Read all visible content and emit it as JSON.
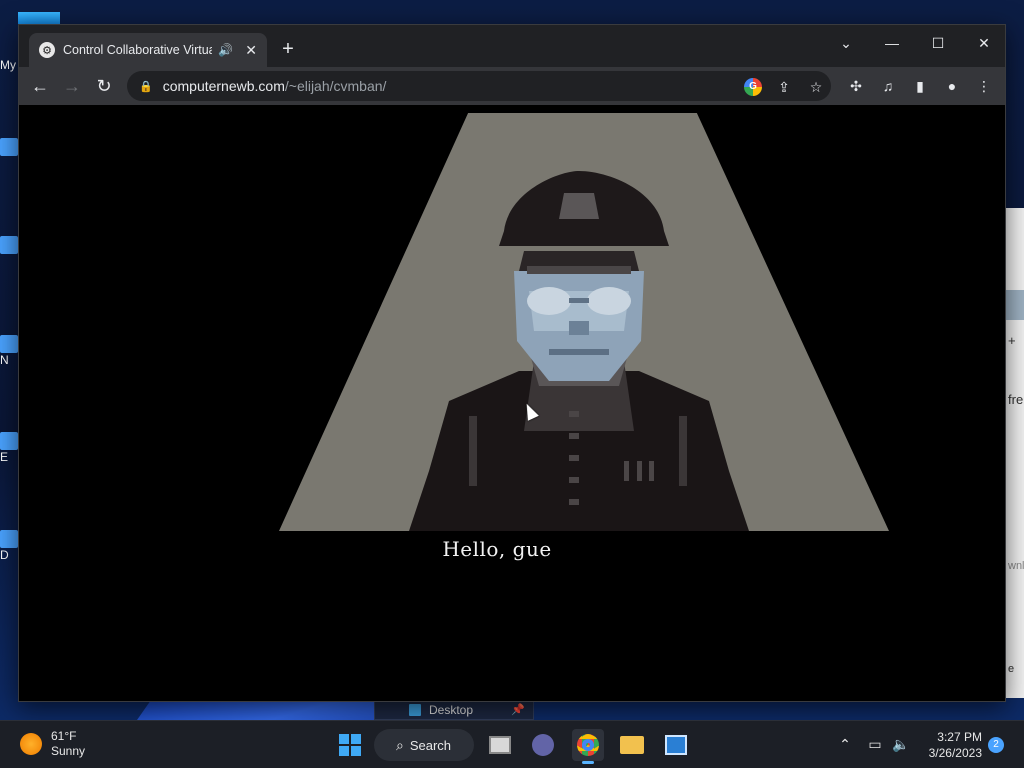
{
  "desktop": {
    "icon_labels": [
      "My",
      "N",
      "E",
      "D"
    ],
    "right_window_texts": [
      "fre",
      "wnl",
      "e"
    ],
    "pinned_label": "Desktop"
  },
  "browser": {
    "tab_title": "Control Collaborative Virtual",
    "url_host": "computernewb.com",
    "url_path": "/~elijah/cvmban/",
    "new_tab_label": "+"
  },
  "game": {
    "dialogue": "Hello, gue"
  },
  "taskbar": {
    "weather_temp": "61°F",
    "weather_desc": "Sunny",
    "search_label": "Search",
    "time": "3:27 PM",
    "date": "3/26/2023",
    "notification_count": "2"
  },
  "colors": {
    "spotlight": "#7a7870",
    "face": "#8ea3b8",
    "uniform": "#1a1516",
    "accent": "#59b4ff"
  }
}
